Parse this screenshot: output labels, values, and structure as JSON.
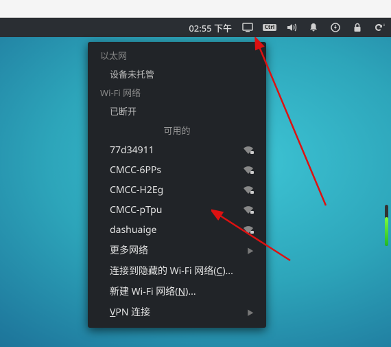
{
  "panel": {
    "clock": "02:55 下午",
    "icons": {
      "display": "display-icon",
      "ctrl": "Ctrl",
      "volume": "volume-icon",
      "bell": "bell-icon",
      "power": "power-icon",
      "lock": "lock-icon",
      "refresh": "refresh-icon"
    }
  },
  "menu": {
    "ethernet": {
      "title": "以太网",
      "status": "设备未托管"
    },
    "wifi": {
      "title": "Wi-Fi 网络",
      "status": "已断开",
      "available_label": "可用的",
      "networks": [
        {
          "ssid": "77d34911",
          "locked": true
        },
        {
          "ssid": "CMCC-6PPs",
          "locked": true
        },
        {
          "ssid": "CMCC-H2Eg",
          "locked": true
        },
        {
          "ssid": "CMCC-pTpu",
          "locked": true
        },
        {
          "ssid": "dashuaige",
          "locked": true
        }
      ],
      "more_networks": "更多网络",
      "connect_hidden": "连接到隐藏的 Wi-Fi 网络(C)...",
      "create_new": "新建 Wi-Fi 网络(N)...",
      "vpn": "VPN 连接",
      "hotkeys": {
        "connect": "C",
        "new": "N",
        "vpn": "V"
      }
    }
  }
}
